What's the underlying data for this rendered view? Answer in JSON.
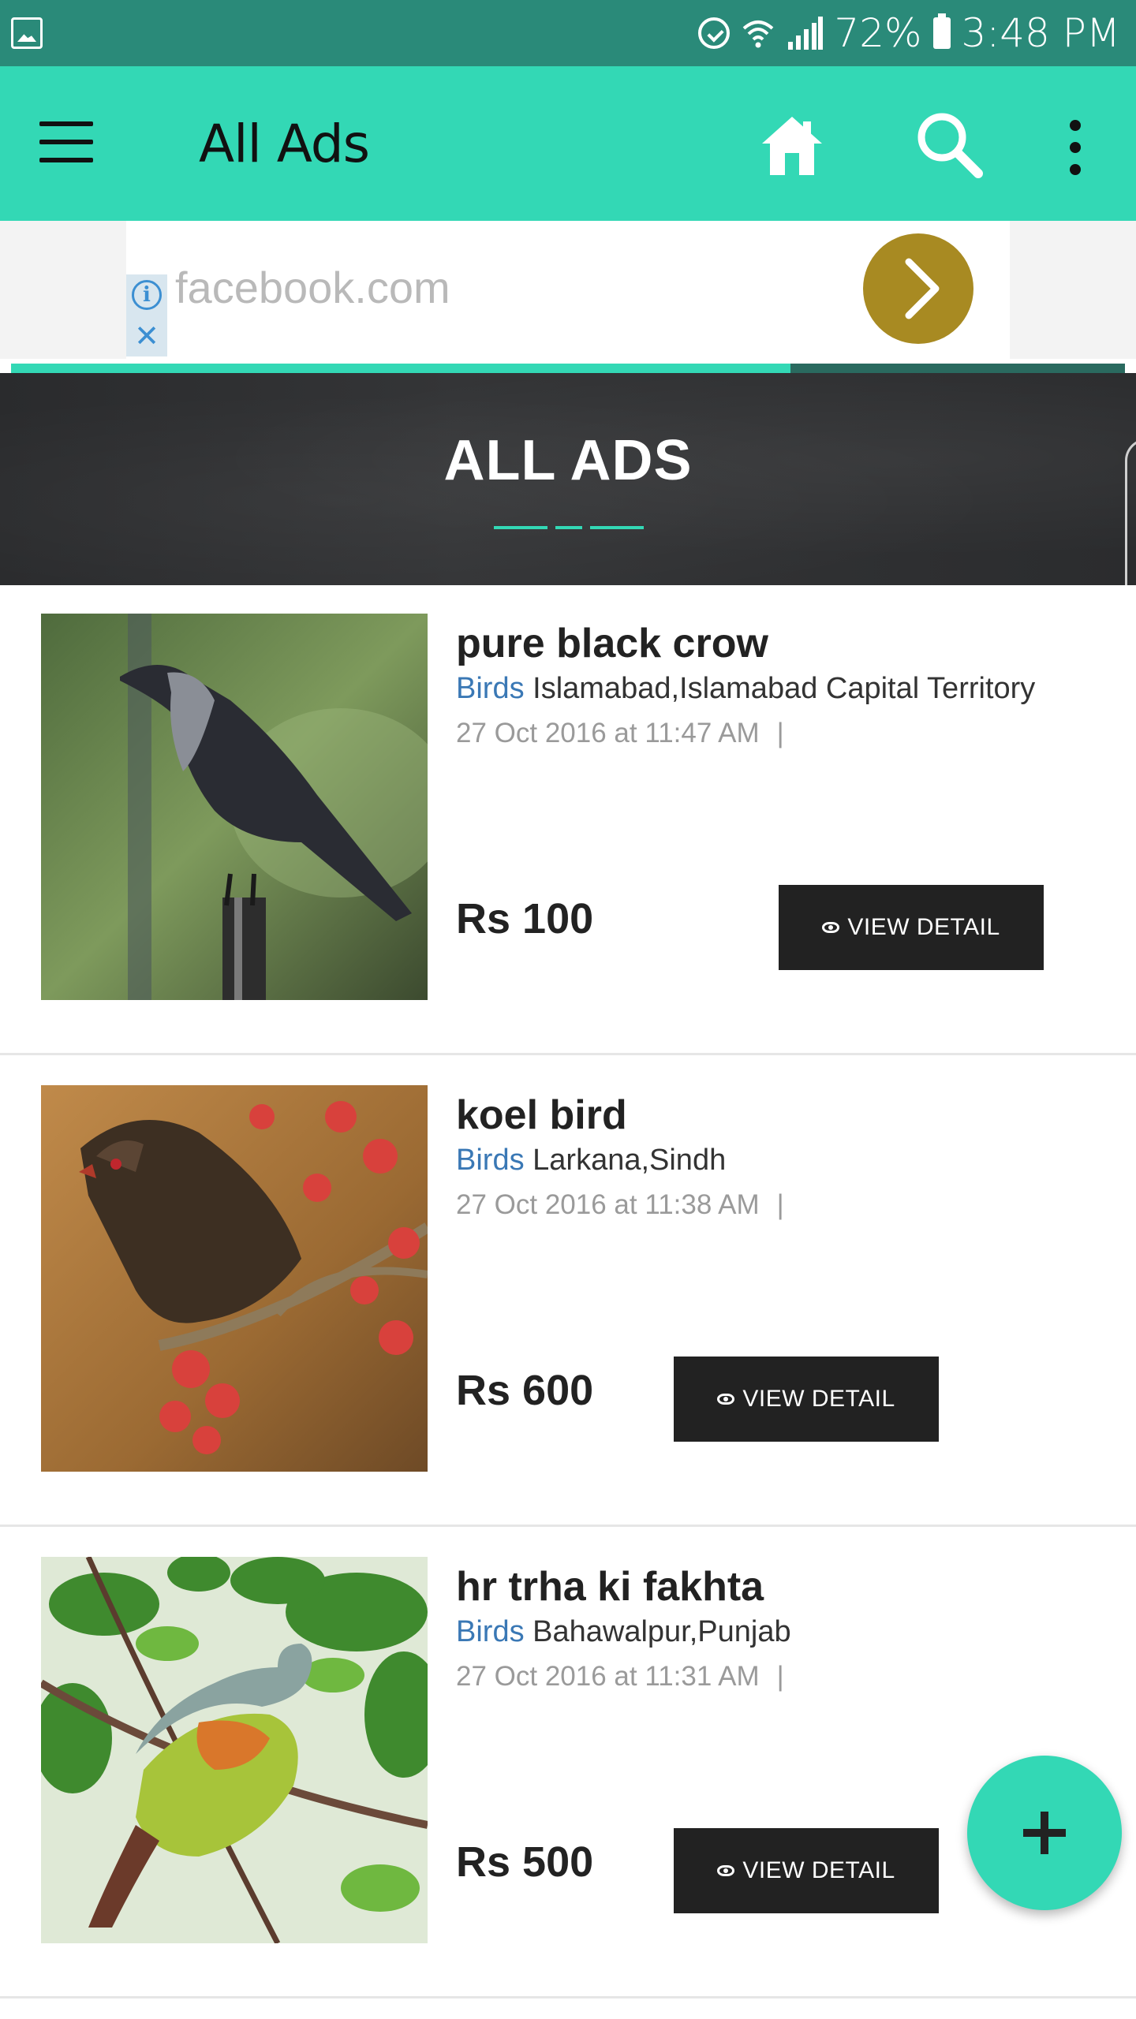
{
  "status_bar": {
    "battery": "72%",
    "time": "3:48 PM",
    "icons": [
      "gallery-icon",
      "alarm-icon",
      "wifi-icon",
      "signal-icon",
      "battery-icon"
    ]
  },
  "toolbar": {
    "title": "All Ads",
    "icons": [
      "menu-icon",
      "home-icon",
      "search-icon",
      "more-vert-icon"
    ],
    "accent_color": "#33d8b5"
  },
  "ad_banner": {
    "url": "facebook.com",
    "info_glyph": "i",
    "close_glyph": "✕",
    "arrow_color": "#a88a22"
  },
  "progress": {
    "value": 0.7
  },
  "hero": {
    "title": "ALL ADS"
  },
  "listings": [
    {
      "name": "pure black crow",
      "category": "Birds",
      "location": "Islamabad,Islamabad Capital Territory",
      "date": "27 Oct 2016 at 11:47 AM",
      "separator": "|",
      "price": "Rs 100",
      "button_label": "VIEW DETAIL"
    },
    {
      "name": "koel bird",
      "category": "Birds",
      "location": "Larkana,Sindh",
      "date": "27 Oct 2016 at 11:38 AM",
      "separator": "|",
      "price": "Rs 600",
      "button_label": "VIEW DETAIL"
    },
    {
      "name": "hr trha ki fakhta",
      "category": "Birds",
      "location": "Bahawalpur,Punjab",
      "date": "27 Oct 2016 at 11:31 AM",
      "separator": "|",
      "price": "Rs 500",
      "button_label": "VIEW DETAIL"
    }
  ],
  "fab": {
    "icon": "plus-icon"
  }
}
